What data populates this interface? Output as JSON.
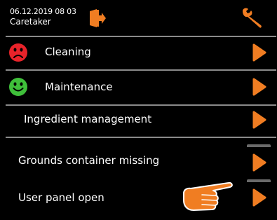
{
  "header": {
    "datetime": "06.12.2019 08 03",
    "role": "Caretaker",
    "logout_icon": "logout-door-icon",
    "settings_icon": "wrench-icon"
  },
  "menu": [
    {
      "label": "Cleaning",
      "status": "bad",
      "status_icon": "sad-face-icon",
      "status_color": "#e8232a"
    },
    {
      "label": "Maintenance",
      "status": "good",
      "status_icon": "happy-face-icon",
      "status_color": "#3fbf3a"
    },
    {
      "label": "Ingredient management"
    }
  ],
  "messages": [
    {
      "label": "Grounds container missing"
    },
    {
      "label": "User panel open"
    }
  ],
  "colors": {
    "accent": "#f07d22",
    "background": "#000000",
    "separator": "#8a8a8a"
  },
  "pointer_icon": "pointing-hand-icon"
}
